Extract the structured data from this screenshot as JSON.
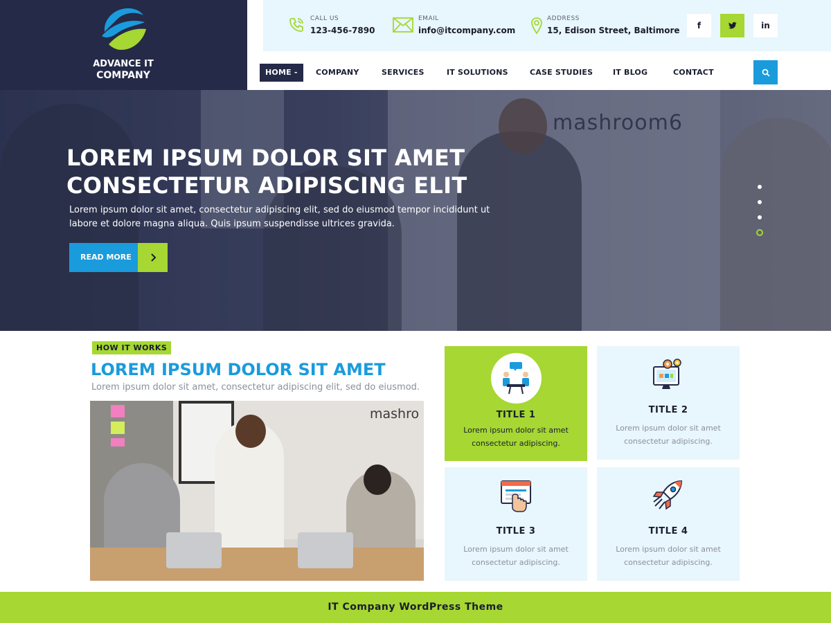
{
  "brand": {
    "name_line1": "ADVANCE IT",
    "name_line2": "COMPANY",
    "colors": {
      "navy": "#252a48",
      "blue": "#1a9bdc",
      "green": "#a6d732",
      "light": "#e8f6fd"
    }
  },
  "contact": {
    "call": {
      "label": "CALL US",
      "value": "123-456-7890",
      "icon": "phone-icon"
    },
    "email": {
      "label": "EMAIL",
      "value": "info@itcompany.com",
      "icon": "envelope-icon"
    },
    "address": {
      "label": "ADDRESS",
      "value": "15, Edison Street, Baltimore",
      "icon": "map-pin-icon"
    }
  },
  "social": {
    "facebook": "f",
    "twitter": "twitter-icon",
    "linkedin": "in"
  },
  "nav": {
    "items": [
      {
        "label": "HOME",
        "active": true
      },
      {
        "label": "COMPANY"
      },
      {
        "label": "SERVICES"
      },
      {
        "label": "IT SOLUTIONS"
      },
      {
        "label": "CASE STUDIES"
      },
      {
        "label": "IT BLOG"
      },
      {
        "label": "CONTACT"
      }
    ],
    "search_icon": "search-icon"
  },
  "hero": {
    "title_line1": "LOREM IPSUM DOLOR SIT AMET",
    "title_line2": "CONSECTETUR ADIPISCING ELIT",
    "description_line1": "Lorem ipsum dolor sit amet, consectetur adipiscing elit, sed do eiusmod tempor incididunt ut",
    "description_line2": "labore et dolore magna aliqua. Quis ipsum suspendisse ultrices gravida.",
    "button_label": "READ MORE",
    "slides": 4,
    "active_slide": 4,
    "background_sign": "mashroom6"
  },
  "how_it_works": {
    "badge": "HOW IT WORKS",
    "title": "LOREM IPSUM DOLOR SIT AMET",
    "subtitle": "Lorem ipsum dolor sit amet, consectetur adipiscing elit, sed do eiusmod.",
    "photo_sign": "mashro"
  },
  "features": [
    {
      "title": "TITLE 1",
      "desc_line1": "Lorem ipsum dolor sit amet",
      "desc_line2": "consectetur adipiscing.",
      "icon": "meeting-icon"
    },
    {
      "title": "TITLE 2",
      "desc_line1": "Lorem ipsum dolor sit amet",
      "desc_line2": "consectetur adipiscing.",
      "icon": "monitor-gears-icon"
    },
    {
      "title": "TITLE 3",
      "desc_line1": "Lorem ipsum dolor sit amet",
      "desc_line2": "consectetur adipiscing.",
      "icon": "click-browser-icon"
    },
    {
      "title": "TITLE 4",
      "desc_line1": "Lorem ipsum dolor sit amet",
      "desc_line2": "consectetur adipiscing.",
      "icon": "rocket-icon"
    }
  ],
  "footer": {
    "text": "IT Company WordPress Theme"
  }
}
